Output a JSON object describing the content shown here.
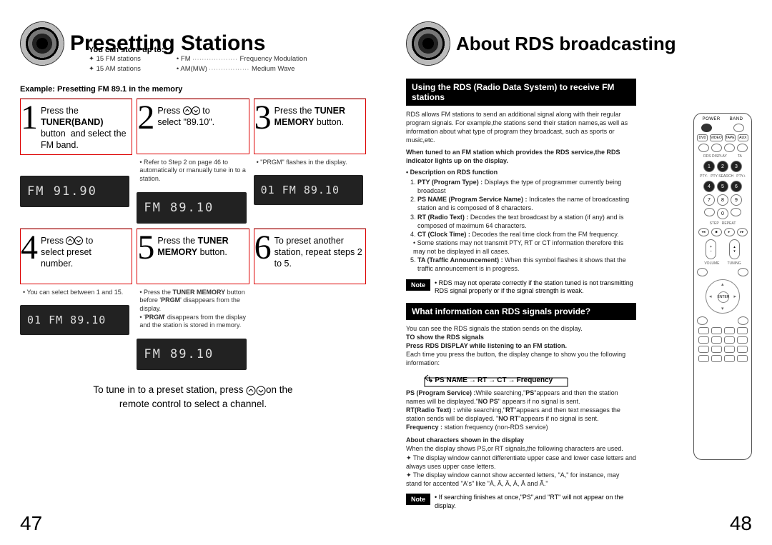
{
  "pageLeft": {
    "title": "Presetting Stations",
    "storeUpTo": "You can store up to:",
    "capacities": [
      "✦ 15 FM stations",
      "✦ 15 AM stations"
    ],
    "legend": [
      "• FM",
      "Frequency Modulation",
      "• AM(MW)",
      "Medium Wave"
    ],
    "exampleLine": "Example: Presetting FM 89.1 in the memory",
    "steps": {
      "s1": {
        "n": "1",
        "t": "Press the <b>TUNER(BAND)</b> button  and select the FM band.",
        "sub": "",
        "disp": "FM  91.90"
      },
      "s2": {
        "n": "2",
        "t": "Press ⬆⬇ to select \"89.10\".",
        "sub": "• Refer to Step 2 on page 46 to automatically or manually tune in to a station.",
        "disp": "FM  89.10"
      },
      "s3": {
        "n": "3",
        "t": "Press the <b>TUNER MEMORY</b> button.",
        "sub": "• \"PRGM\" flashes in the display.",
        "disp": "01  FM  89.10"
      },
      "s4": {
        "n": "4",
        "t": "Press ⬆⬇ to select preset number.",
        "sub": "• You can select between 1 and 15.",
        "disp": "01 FM  89.10"
      },
      "s5": {
        "n": "5",
        "t": "Press the <b>TUNER MEMORY</b> button.",
        "sub": "• Press the TUNER MEMORY button before 'PRGM' disappears from the display.\n• 'PRGM' disappears from the display and the station is stored in memory.",
        "disp": "FM  89.10"
      },
      "s6": {
        "n": "6",
        "t": "To preset another station, repeat steps 2 to 5.",
        "sub": "",
        "disp": ""
      }
    },
    "footer": "To tune in to a preset station, press ⬆⬇ on the remote control to select a channel.",
    "pageNum": "47"
  },
  "pageRight": {
    "title": "About RDS broadcasting",
    "bar1": "Using the RDS (Radio Data System) to receive FM stations",
    "rdsIntro": "RDS allows FM stations to send an additional signal along with their regular program signals. For example,the stations send their station names,as well as information about what type of program they broadcast, such as sports or music,etc.",
    "rdsTuned": "When tuned to an FM station which provides the RDS service,the RDS indicator lights up on the display.",
    "rdsDescHead": "• Description on RDS function",
    "rdsList": {
      "i1": "PTY (Program Type) : Displays the type of programmer currently being broadcast",
      "i2": "PS NAME (Program Service Name) : Indicates the name of broadcasting station and is composed of 8 characters.",
      "i3": "RT (Radio Text) : Decodes the text broadcast by a station (if any) and is composed of maximum 64 characters.",
      "i4": "CT (Clock Time) : Decodes the real time clock from the FM frequency.",
      "i4sub": "• Some stations may not transmit PTY, RT or CT information therefore this may not be displayed in all cases.",
      "i5": "TA (Traffic Announcement) : When this symbol flashes it shows that the traffic announcement is in progress."
    },
    "note1": "RDS may not operate correctly if the station tuned is not transmitting RDS signal properly or if the signal strength is weak.",
    "bar2": "What information can RDS signals provide?",
    "provideIntro": "You can see the RDS signals the station sends on the display.",
    "toShowHead": "TO show the RDS signals",
    "toShow1": "Press RDS DISPLAY while listening to an FM station.",
    "toShow2": "Each time you press the button, the display change to show you the following information:",
    "flow": [
      "PS NAME",
      "RT",
      "CT",
      "Frequency"
    ],
    "psDesc": "PS (Program Service) :While searching,\"PS\"appears and then the station names will be displayed.\"NO PS\" appears if no signal is sent.",
    "rtDesc": "RT(Radio Text) : while searching,\"RT\"appears and then text messages the station sends will be displayed. \"NO RT\"appears if no signal is sent.",
    "freqDesc": "Frequency : station frequency (non-RDS service)",
    "aboutCharsHead": "About characters shown in the display",
    "aboutChars1": "When the display shows PS,or RT signals,the following characters are used.",
    "aboutCharsB1": "The display window cannot differentiate upper case and lower case letters and always uses upper case letters.",
    "aboutCharsB2": "The display window cannot show accented letters, \"A,\" for instance, may stand for accented \"A's\" like \"À, Â, Ä, Á, Å and Ã.\"",
    "note2": "If searching finishes at once,\"PS\",and \"RT\" will not appear on the display.",
    "pageNum": "48",
    "remote": {
      "row1": [
        "DVD",
        "VIDEO",
        "TAPE",
        "AUX"
      ],
      "numpad": [
        "1",
        "2",
        "3",
        "4",
        "5",
        "6",
        "7",
        "8",
        "9",
        "0"
      ],
      "enter": "ENTER"
    }
  }
}
